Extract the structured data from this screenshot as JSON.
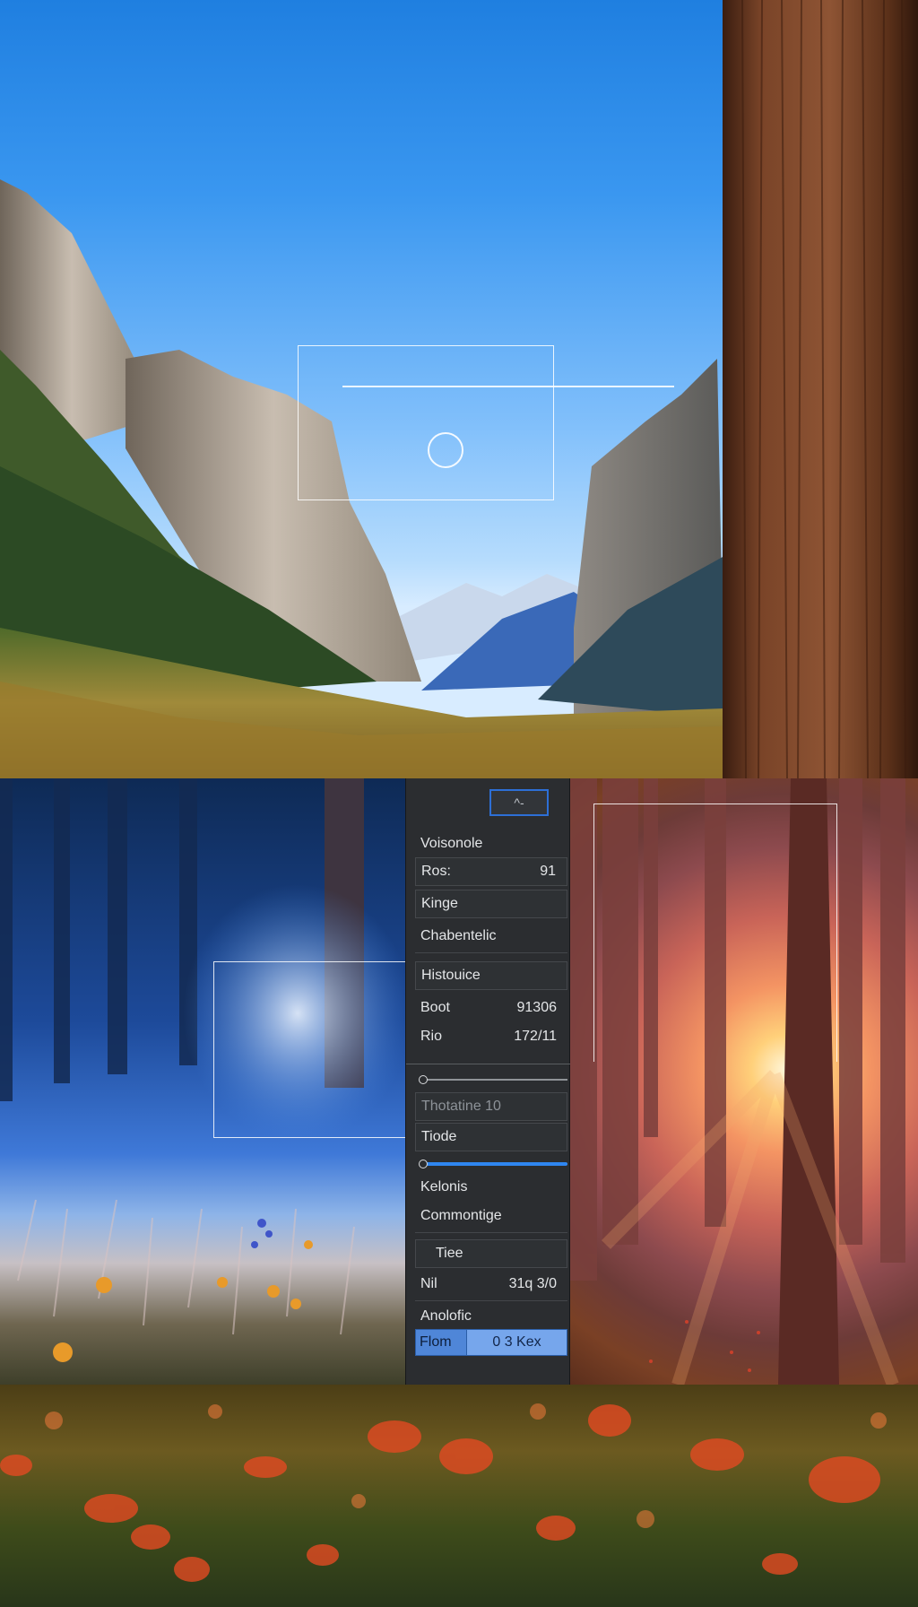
{
  "panel": {
    "top_button_label": "^-",
    "rows": {
      "volume": "Voisonole",
      "ros_label": "Ros:",
      "ros_value": "91",
      "kinge": "Kinge",
      "characteristic": "Chabentelic",
      "histogram": "Histouice",
      "boot_label": "Boot",
      "boot_value": "91306",
      "rio_label": "Rio",
      "rio_value": "172/11",
      "threshold": "Thotatine 10",
      "tiode": "Tiode",
      "kelonis": "Kelonis",
      "commontige": "Commontige",
      "tiee": "Tiee",
      "nil_label": "Nil",
      "nil_value": "31q 3/0",
      "analog": "Anolofic",
      "film_label": "Flom",
      "film_value": "0 3  Kex"
    },
    "slider_1": {
      "value": 0.0
    },
    "slider_2": {
      "value": 1.0
    }
  }
}
